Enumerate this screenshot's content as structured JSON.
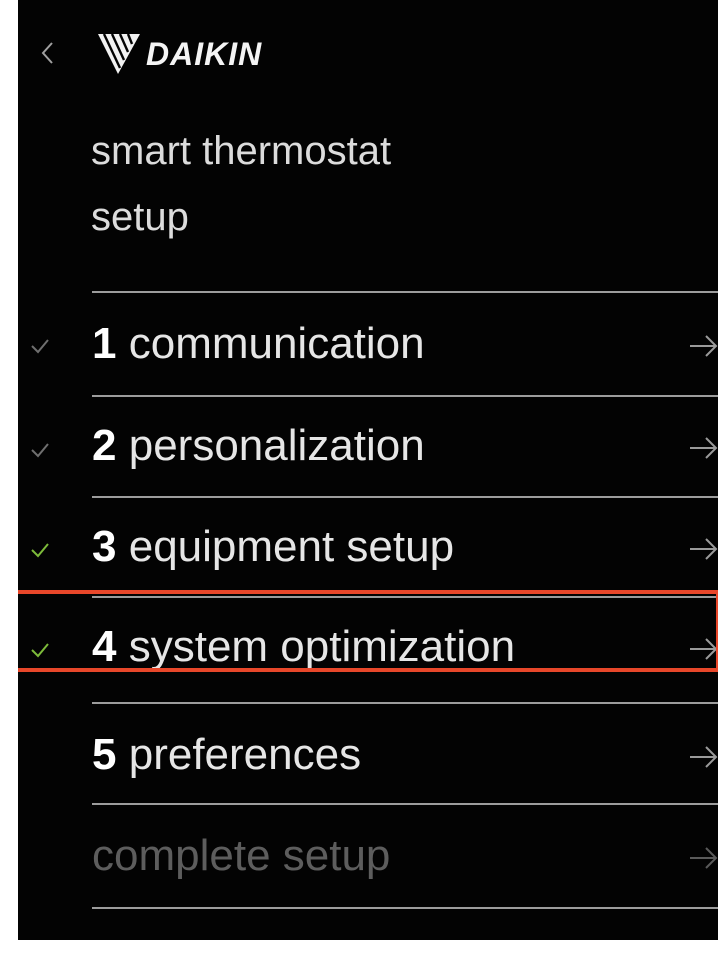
{
  "header": {
    "brand": "DAIKIN",
    "title_line1": "smart thermostat",
    "title_line2": "setup"
  },
  "steps": [
    {
      "number": "1",
      "label": "communication",
      "completed": true,
      "check_color": "#6f6f6f"
    },
    {
      "number": "2",
      "label": "personalization",
      "completed": true,
      "check_color": "#6f6f6f"
    },
    {
      "number": "3",
      "label": "equipment setup",
      "completed": true,
      "check_color": "#7dbb3a"
    },
    {
      "number": "4",
      "label": "system optimization",
      "completed": true,
      "check_color": "#7dbb3a",
      "highlighted": true
    },
    {
      "number": "5",
      "label": "preferences",
      "completed": false
    },
    {
      "number": "",
      "label": "complete setup",
      "completed": false,
      "disabled": true
    }
  ],
  "colors": {
    "background": "#030303",
    "highlight": "#e8472a",
    "divider": "#9c9c9c"
  },
  "icons": {
    "back": "chevron-left-icon",
    "arrow": "arrow-right-icon",
    "check": "check-icon",
    "logo": "daikin-logo-icon"
  }
}
